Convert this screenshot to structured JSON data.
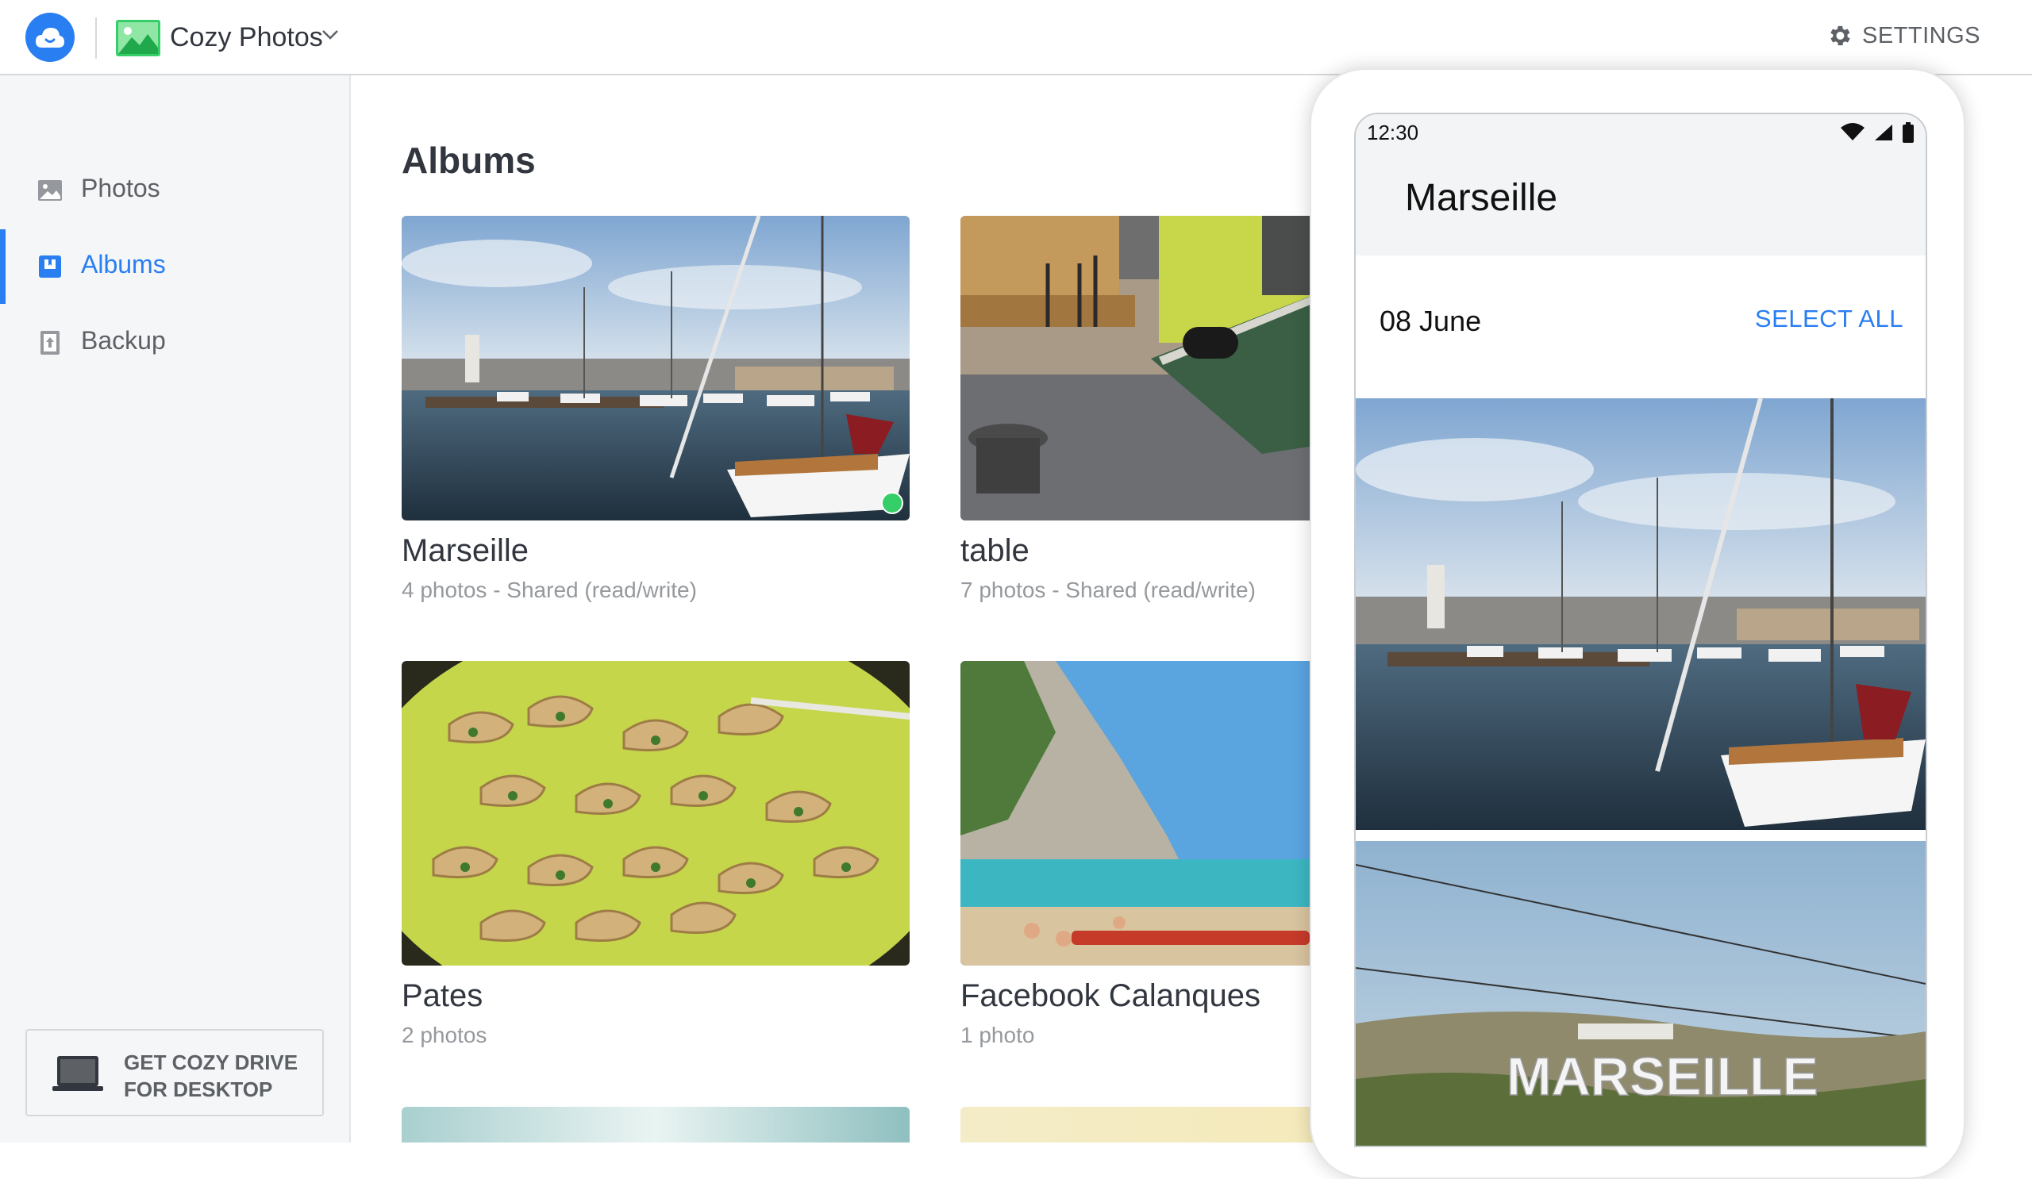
{
  "header": {
    "app_name": "Cozy Photos",
    "settings_label": "SETTINGS"
  },
  "sidebar": {
    "items": [
      {
        "label": "Photos"
      },
      {
        "label": "Albums"
      },
      {
        "label": "Backup"
      }
    ],
    "desktop_promo_line1": "GET COZY DRIVE",
    "desktop_promo_line2": "FOR DESKTOP"
  },
  "main": {
    "title": "Albums",
    "albums": [
      {
        "name": "Marseille",
        "meta": "4 photos - Shared (read/write)"
      },
      {
        "name": "table",
        "meta": "7 photos - Shared (read/write)"
      },
      {
        "name": "Pates",
        "meta": "2 photos"
      },
      {
        "name": "Facebook Calanques",
        "meta": "1 photo"
      }
    ]
  },
  "phone": {
    "time": "12:30",
    "album_title": "Marseille",
    "date": "08 June",
    "select_all": "SELECT ALL",
    "sign_text": "MARSEILLE"
  },
  "colors": {
    "accent": "#297ef2",
    "shared_badge": "#35ce68"
  }
}
